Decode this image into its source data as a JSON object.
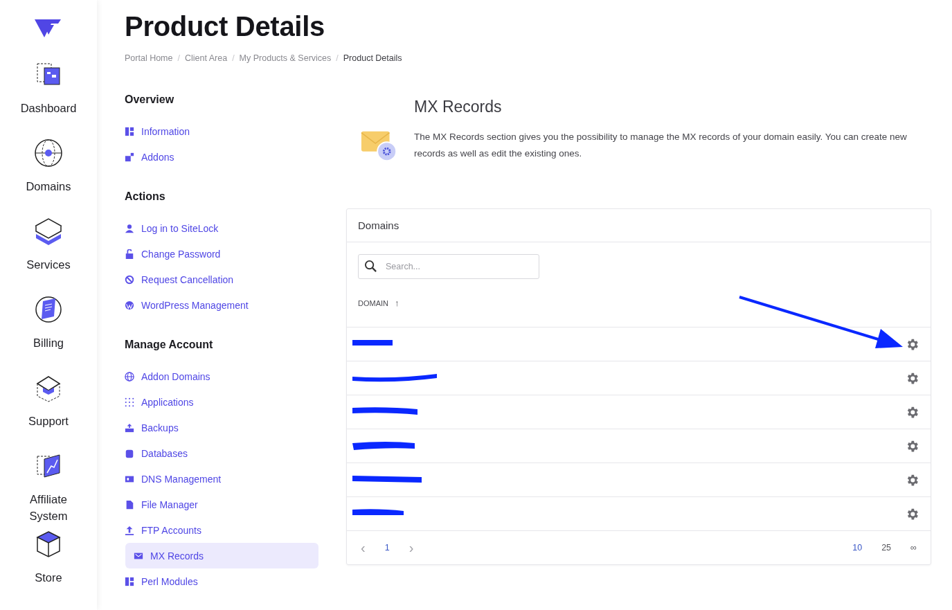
{
  "sidebar": {
    "items": [
      {
        "label": "Dashboard",
        "kind": "dashboard"
      },
      {
        "label": "Domains",
        "kind": "globe"
      },
      {
        "label": "Services",
        "kind": "server"
      },
      {
        "label": "Billing",
        "kind": "billing"
      },
      {
        "label": "Support",
        "kind": "support"
      },
      {
        "label": "Affiliate System",
        "kind": "affiliate"
      },
      {
        "label": "Store",
        "kind": "store"
      }
    ]
  },
  "page": {
    "title": "Product Details",
    "breadcrumb": [
      {
        "label": "Portal Home",
        "current": false
      },
      {
        "label": "Client Area",
        "current": false
      },
      {
        "label": "My Products & Services",
        "current": false
      },
      {
        "label": "Product Details",
        "current": true
      }
    ],
    "breadcrumb_separator": "/"
  },
  "menu": [
    {
      "heading": "Overview",
      "items": [
        {
          "label": "Information",
          "kind": "blocks",
          "selected": false
        },
        {
          "label": "Addons",
          "kind": "addons",
          "selected": false
        }
      ]
    },
    {
      "heading": "Actions",
      "items": [
        {
          "label": "Log in to SiteLock",
          "kind": "user",
          "selected": false
        },
        {
          "label": "Change Password",
          "kind": "lock",
          "selected": false
        },
        {
          "label": "Request Cancellation",
          "kind": "ban",
          "selected": false
        },
        {
          "label": "WordPress Management",
          "kind": "wordpress",
          "selected": false
        }
      ]
    },
    {
      "heading": "Manage Account",
      "items": [
        {
          "label": "Addon Domains",
          "kind": "globe",
          "selected": false
        },
        {
          "label": "Applications",
          "kind": "grid",
          "selected": false
        },
        {
          "label": "Backups",
          "kind": "backup",
          "selected": false
        },
        {
          "label": "Databases",
          "kind": "database",
          "selected": false
        },
        {
          "label": "DNS Management",
          "kind": "dns",
          "selected": false
        },
        {
          "label": "File Manager",
          "kind": "file",
          "selected": false
        },
        {
          "label": "FTP Accounts",
          "kind": "upload",
          "selected": false
        },
        {
          "label": "MX Records",
          "kind": "mail",
          "selected": true
        },
        {
          "label": "Perl Modules",
          "kind": "blocks",
          "selected": false
        }
      ]
    }
  ],
  "section": {
    "title": "MX Records",
    "description": "The MX Records section gives you the possibility to manage the MX records of your domain easily. You can create new records as well as edit the existing ones."
  },
  "domains_card": {
    "title": "Domains",
    "search": {
      "placeholder": "Search..."
    },
    "column": "DOMAIN",
    "sort_icon": "↑",
    "rows": [
      {
        "kind": "redacted"
      },
      {
        "kind": "redacted"
      },
      {
        "kind": "redacted"
      },
      {
        "kind": "redacted"
      },
      {
        "kind": "redacted"
      },
      {
        "kind": "redacted"
      }
    ],
    "annotation": {
      "kind": "arrow"
    },
    "pager": {
      "prev": "‹",
      "next": "›",
      "pages": [
        {
          "label": "1",
          "selected": true
        }
      ],
      "sizes": [
        {
          "label": "10",
          "selected": true
        },
        {
          "label": "25",
          "selected": false
        },
        {
          "label": "∞",
          "selected": false
        }
      ]
    }
  }
}
